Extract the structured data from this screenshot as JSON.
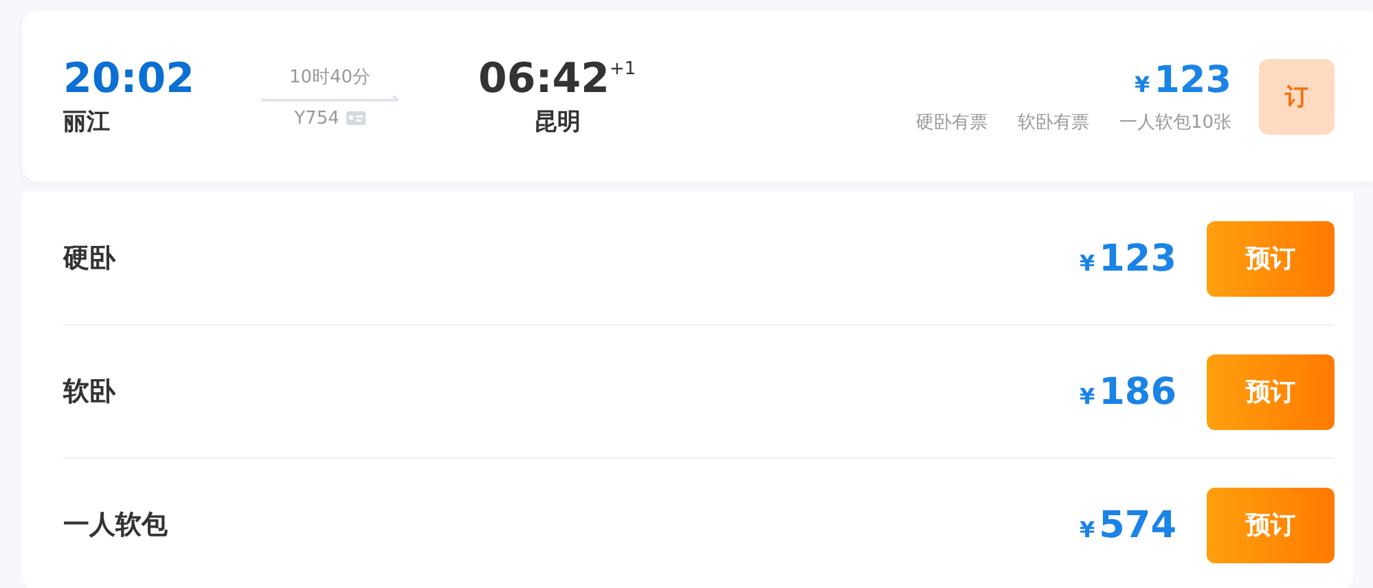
{
  "train": {
    "depart_time": "20:02",
    "depart_city": "丽江",
    "duration": "10时40分",
    "train_no": "Y754",
    "arrive_time": "06:42",
    "day_offset": "+1",
    "arrive_city": "昆明",
    "currency": "¥",
    "price": "123",
    "availability": [
      "硬卧有票",
      "软卧有票",
      "一人软包10张"
    ],
    "book_label": "订",
    "expanded": true
  },
  "seats": [
    {
      "name": "硬卧",
      "currency": "¥",
      "price": "123",
      "button": "预订"
    },
    {
      "name": "软卧",
      "currency": "¥",
      "price": "186",
      "button": "预订"
    },
    {
      "name": "一人软包",
      "currency": "¥",
      "price": "574",
      "button": "预订"
    }
  ]
}
